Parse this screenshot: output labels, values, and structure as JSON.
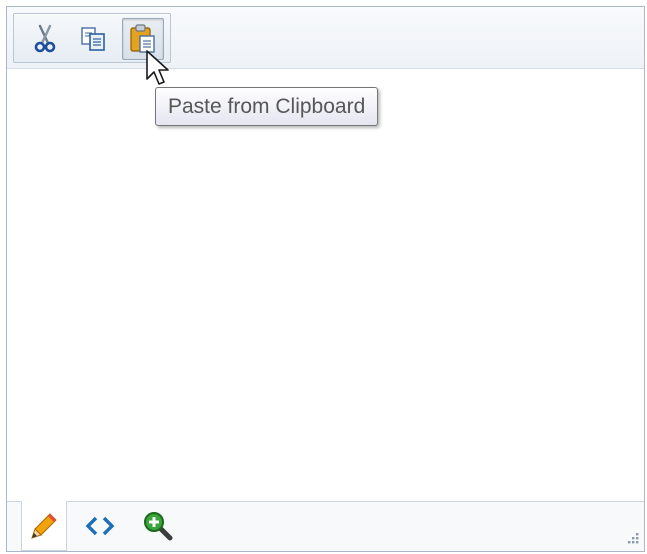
{
  "toolbar": {
    "buttons": [
      {
        "name": "Cut",
        "icon": "scissors-icon"
      },
      {
        "name": "Copy",
        "icon": "copy-icon"
      },
      {
        "name": "Paste from Clipboard",
        "icon": "paste-icon",
        "state": "pressed"
      }
    ]
  },
  "tooltip": {
    "text": "Paste from Clipboard"
  },
  "modes": [
    {
      "name": "Design",
      "icon": "pencil-icon",
      "active": true
    },
    {
      "name": "HTML",
      "icon": "code-icon",
      "active": false
    },
    {
      "name": "Preview",
      "icon": "zoom-icon",
      "active": false
    }
  ],
  "colors": {
    "border": "#a9b7c6",
    "toolbar_bg": "#eef2f7",
    "tooltip_text": "#575757",
    "accent_blue": "#1f6fb8",
    "accent_green": "#2e9b2e"
  }
}
